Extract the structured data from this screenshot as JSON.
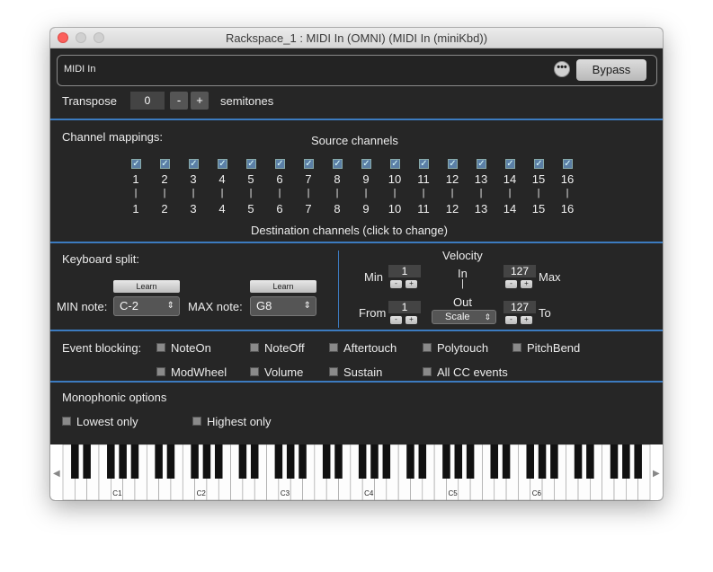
{
  "window": {
    "title": "Rackspace_1 : MIDI In (OMNI) (MIDI In (miniKbd))"
  },
  "header": {
    "plugin_name": "MIDI In",
    "more_symbol": "•••",
    "bypass_label": "Bypass"
  },
  "transpose": {
    "label": "Transpose",
    "value": "0",
    "minus": "-",
    "plus": "+",
    "unit": "semitones"
  },
  "channels": {
    "section_label": "Channel mappings:",
    "source_label": "Source channels",
    "destination_label": "Destination channels (click to change)",
    "source": [
      "1",
      "2",
      "3",
      "4",
      "5",
      "6",
      "7",
      "8",
      "9",
      "10",
      "11",
      "12",
      "13",
      "14",
      "15",
      "16"
    ],
    "destination": [
      "1",
      "2",
      "3",
      "4",
      "5",
      "6",
      "7",
      "8",
      "9",
      "10",
      "11",
      "12",
      "13",
      "14",
      "15",
      "16"
    ],
    "checkmark": "✓",
    "bar": "|"
  },
  "split": {
    "label": "Keyboard split:",
    "learn_label": "Learn",
    "min_label": "MIN note:",
    "min_value": "C-2",
    "max_label": "MAX note:",
    "max_value": "G8",
    "updown": "⇕"
  },
  "velocity": {
    "label": "Velocity",
    "min_label": "Min",
    "min_value": "1",
    "max_label": "Max",
    "max_value": "127",
    "from_label": "From",
    "from_value": "1",
    "to_label": "To",
    "to_value": "127",
    "in_label": "In",
    "out_label": "Out",
    "bar": "|",
    "mode_value": "Scale",
    "minus": "-",
    "plus": "+"
  },
  "blocking": {
    "label": "Event blocking:",
    "items": [
      "NoteOn",
      "NoteOff",
      "Aftertouch",
      "Polytouch",
      "PitchBend",
      "ModWheel",
      "Volume",
      "Sustain",
      "All CC events"
    ]
  },
  "mono": {
    "label": "Monophonic options",
    "lowest": "Lowest only",
    "highest": "Highest only"
  },
  "keyboard": {
    "octave_labels": [
      "C1",
      "C2",
      "C3",
      "C4",
      "C5",
      "C6"
    ],
    "left_arrow": "◀",
    "right_arrow": "▶"
  }
}
